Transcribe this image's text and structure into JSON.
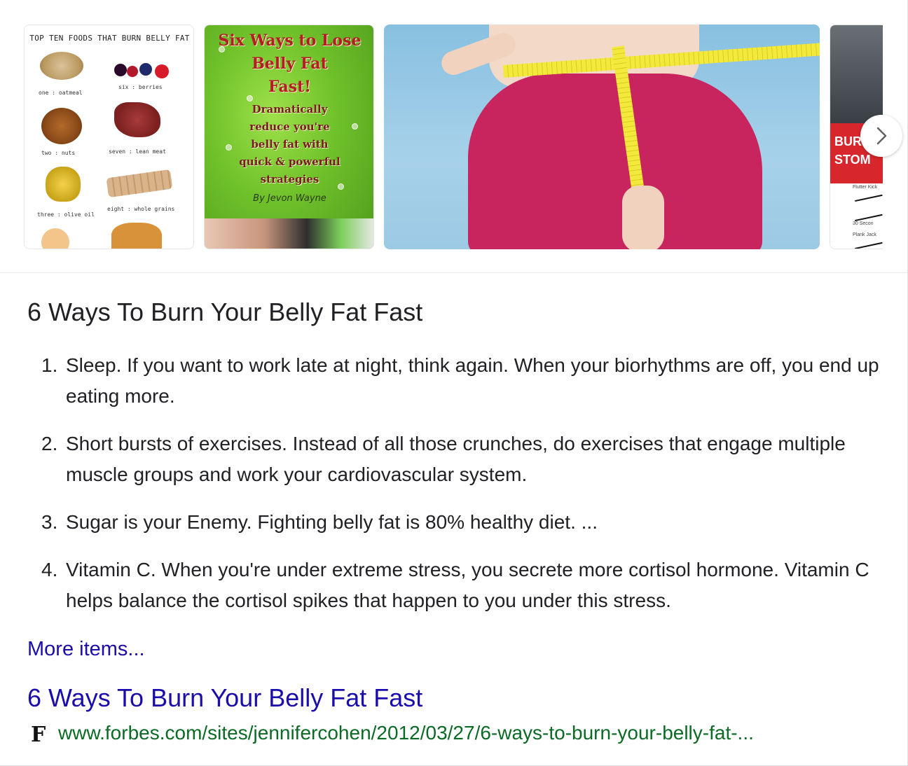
{
  "gallery": {
    "image1": {
      "title": "TOP TEN FOODS THAT BURN BELLY FAT",
      "labels": [
        "one : oatmeal",
        "six : berries",
        "two : nuts",
        "seven : lean meat",
        "three : olive oil",
        "eight : whole grains"
      ]
    },
    "image2": {
      "title_lines": [
        "Six Ways to Lose",
        "Belly Fat",
        "Fast!"
      ],
      "subtitle_lines": [
        "Dramatically",
        "reduce you're",
        "belly fat with",
        "quick & powerful",
        "strategies"
      ],
      "author": "By Jevon Wayne"
    },
    "image4": {
      "lines": [
        "BUR",
        "STOM"
      ],
      "captions": [
        "Flutter Kick",
        "30 Secon",
        "Plank Jack"
      ]
    },
    "next_icon": "chevron-right-icon"
  },
  "answer": {
    "heading": "6 Ways To Burn Your Belly Fat Fast",
    "items": [
      {
        "num": "1.",
        "text": "Sleep. If you want to work late at night, think again. When your biorhythms are off, you end up eating more."
      },
      {
        "num": "2.",
        "text": "Short bursts of exercises. Instead of all those crunches, do exercises that engage multiple muscle groups and work your cardiovascular system."
      },
      {
        "num": "3.",
        "text": "Sugar is your Enemy. Fighting belly fat is 80% healthy diet. ..."
      },
      {
        "num": "4.",
        "text": "Vitamin C. When you're under extreme stress, you secrete more cortisol hormone. Vitamin C helps balance the cortisol spikes that happen to you under this stress."
      }
    ],
    "more_items": "More items..."
  },
  "result": {
    "title": "6 Ways To Burn Your Belly Fat Fast",
    "favicon": "F",
    "url": "www.forbes.com/sites/jennifercohen/2012/03/27/6-ways-to-burn-your-belly-fat-..."
  },
  "colors": {
    "link": "#1a0dab",
    "url": "#0b6a24",
    "text": "#202124"
  }
}
